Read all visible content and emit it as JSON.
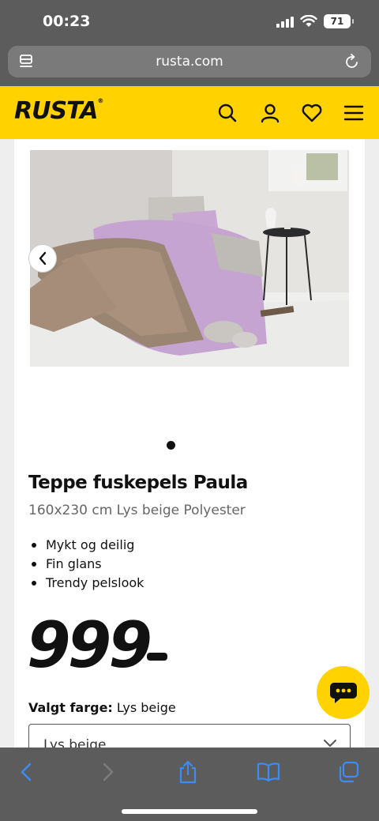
{
  "status_bar": {
    "time": "00:23",
    "battery": "71"
  },
  "browser": {
    "url": "rusta.com"
  },
  "site": {
    "logo": "RUSTA",
    "icons": [
      "search-icon",
      "user-icon",
      "heart-icon",
      "menu-icon"
    ],
    "brand_color": "#ffd200"
  },
  "product": {
    "title": "Teppe fuskepels Paula",
    "subtitle": "160x230 cm Lys beige Polyester",
    "features": [
      "Mykt og deilig",
      "Fin glans",
      "Trendy pelslook"
    ],
    "price": "999",
    "color_label": "Valgt farge:",
    "color_value": "Lys beige",
    "color_select_value": "Lys beige"
  },
  "toolbar": {
    "icons": [
      "back-icon",
      "forward-icon",
      "share-icon",
      "bookmarks-icon",
      "tabs-icon"
    ]
  }
}
